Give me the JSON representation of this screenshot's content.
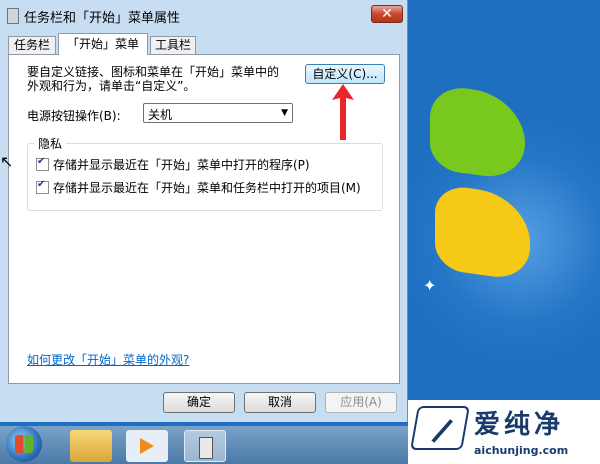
{
  "window": {
    "title": "任务栏和「开始」菜单属性",
    "close_symbol": "✕",
    "icon": "properties-window-icon"
  },
  "tabs": [
    {
      "label": "任务栏",
      "active": false
    },
    {
      "label": "「开始」菜单",
      "active": true
    },
    {
      "label": "工具栏",
      "active": false
    }
  ],
  "start_menu": {
    "description_line1": "要自定义链接、图标和菜单在「开始」菜单中的",
    "description_line2": "外观和行为，请单击“自定义”。",
    "customize_button": "自定义(C)...",
    "power_label": "电源按钮操作(B):",
    "power_value": "关机",
    "privacy_group": "隐私",
    "checkbox1": "存储并显示最近在「开始」菜单中打开的程序(P)",
    "checkbox2": "存储并显示最近在「开始」菜单和任务栏中打开的项目(M)",
    "checkbox1_checked": true,
    "checkbox2_checked": true,
    "help_link": "如何更改「开始」菜单的外观?"
  },
  "buttons": {
    "ok": "确定",
    "cancel": "取消",
    "apply": "应用(A)"
  },
  "watermark": {
    "title": "爱纯净",
    "url": "aichunjing.com"
  },
  "colors": {
    "desktop": "#1f6fc0",
    "arrow": "#e8262c",
    "link": "#0066cc"
  }
}
